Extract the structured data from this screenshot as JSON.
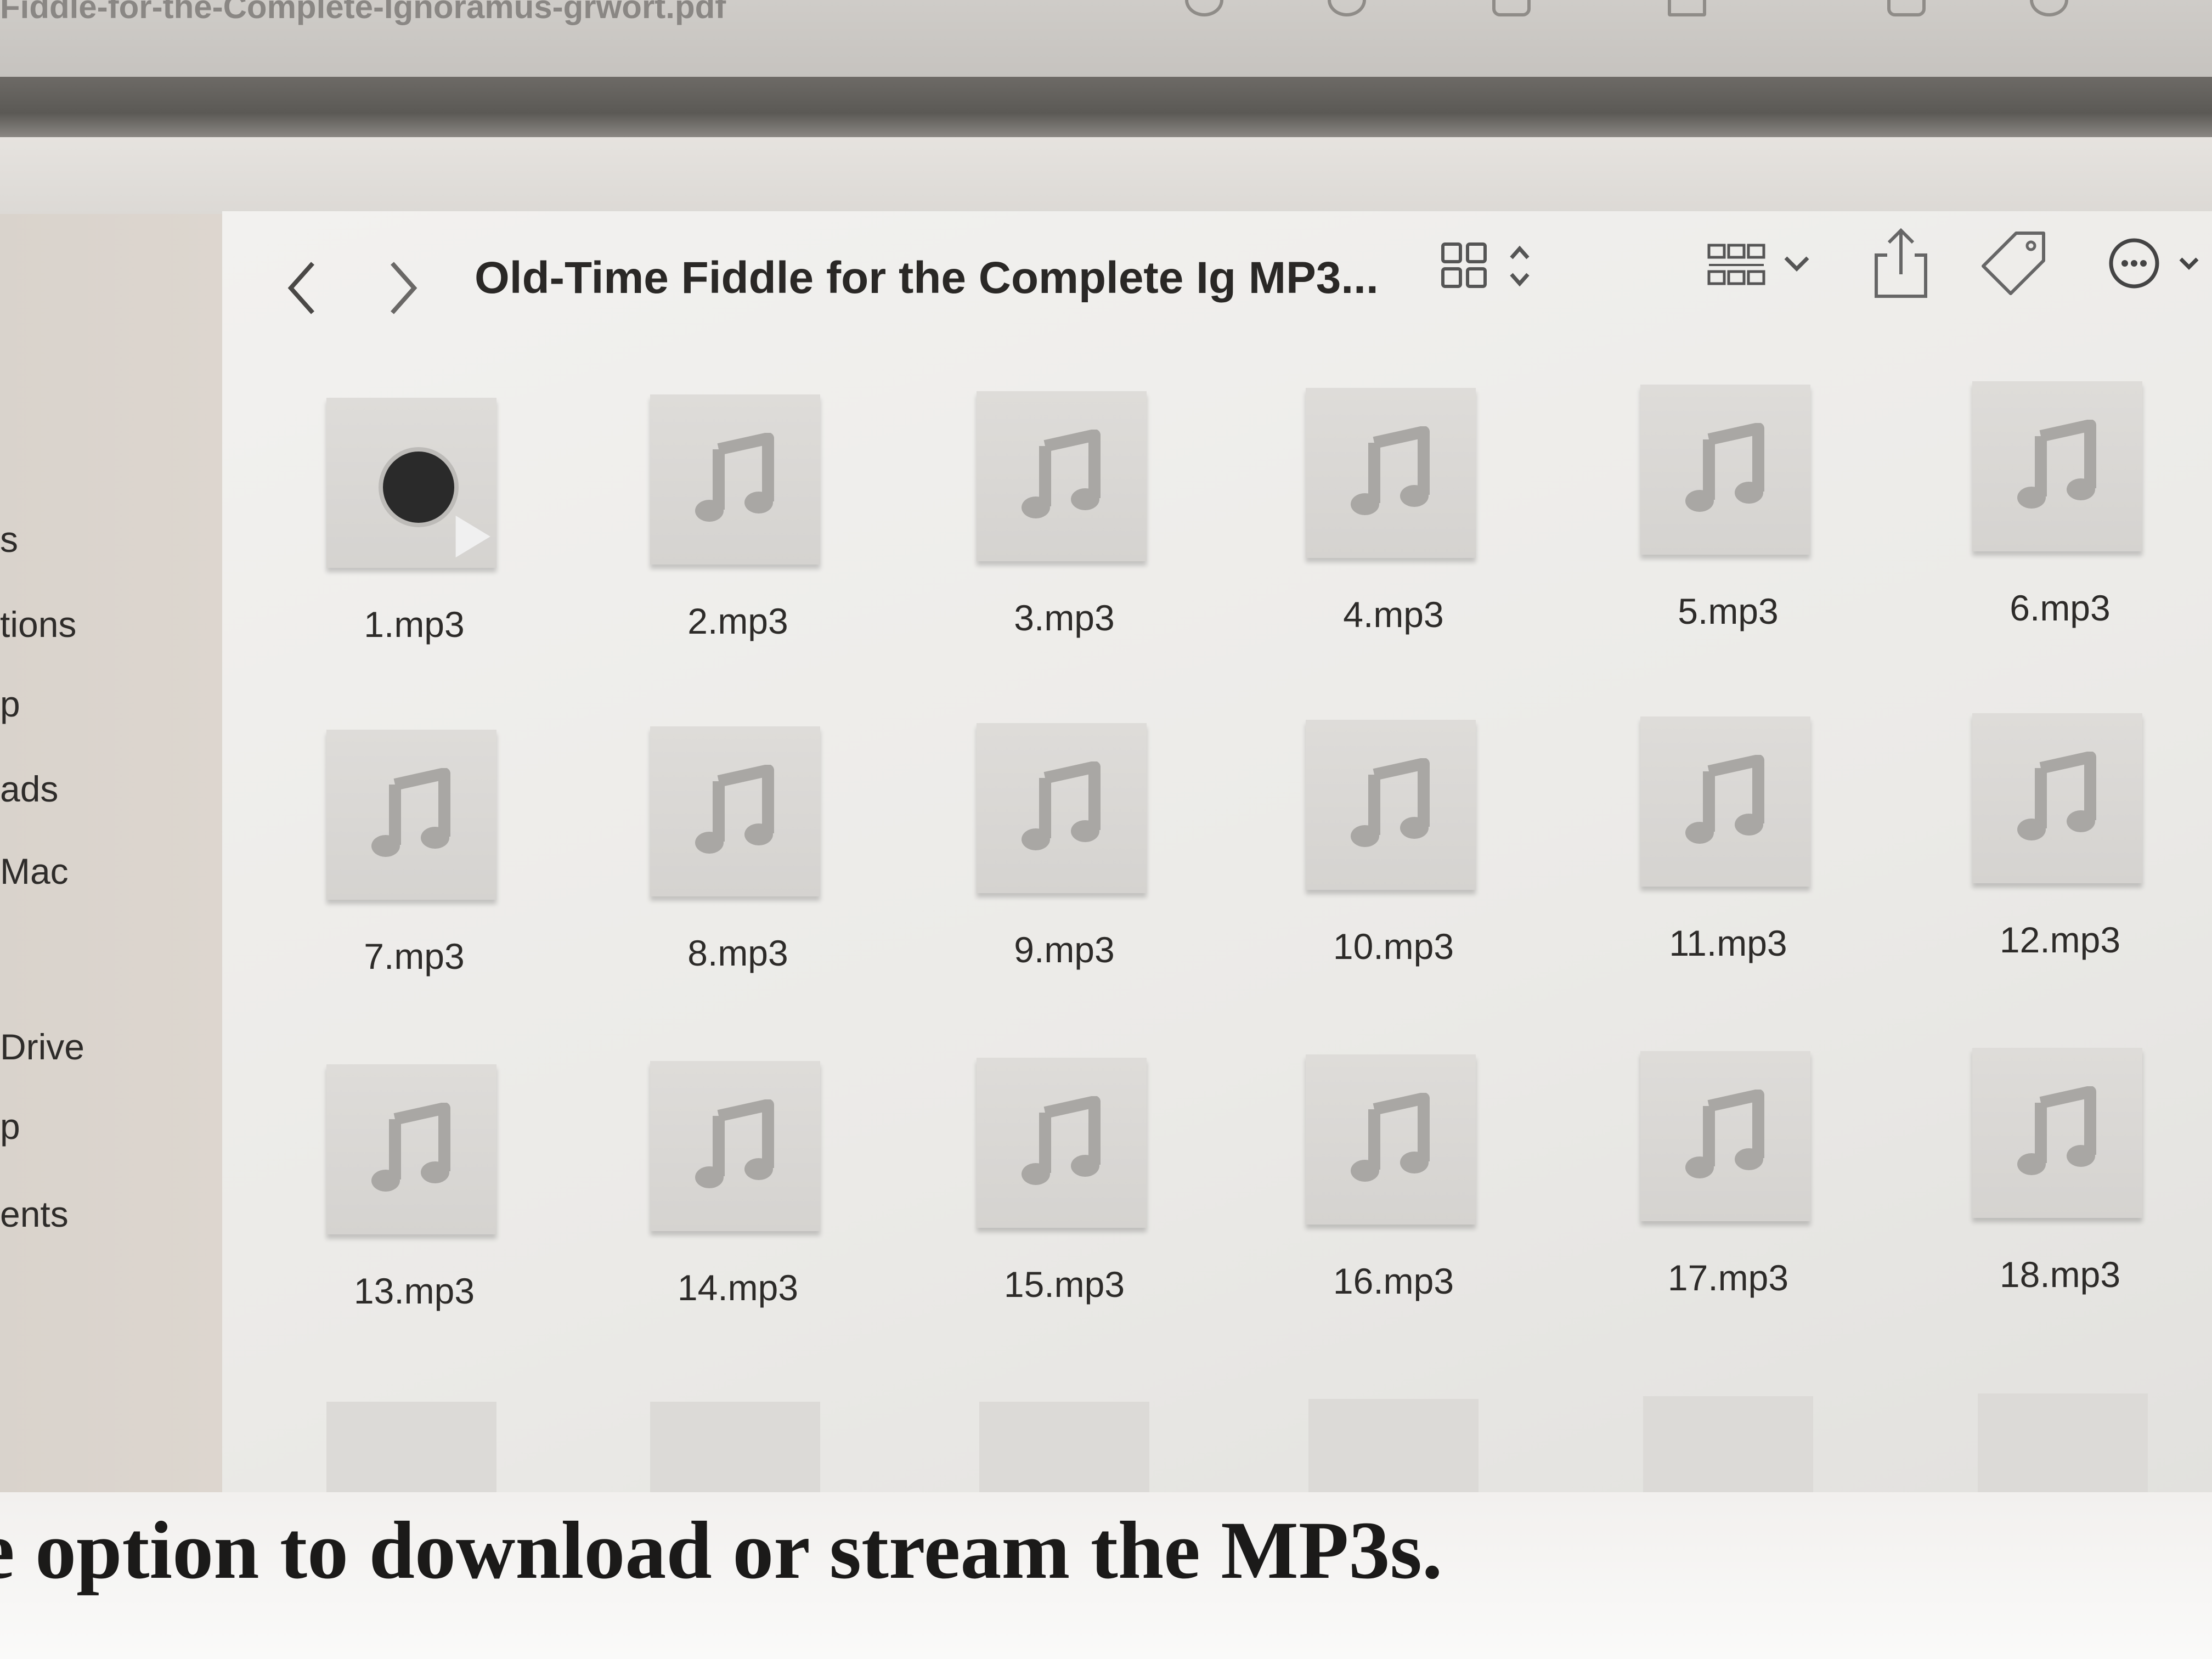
{
  "pdf_window": {
    "title": "Fiddle-for-the-Complete-Ignoramus-grwort.pdf"
  },
  "sidebar": {
    "items": [
      {
        "label": "s"
      },
      {
        "label": "tions"
      },
      {
        "label": "p"
      },
      {
        "label": "ads"
      },
      {
        "label": "Mac"
      },
      {
        "label": "Drive"
      },
      {
        "label": "p"
      },
      {
        "label": "ents"
      }
    ]
  },
  "finder": {
    "title": "Old-Time Fiddle for the Complete Ig MP3...",
    "back_icon": "chevron-left-icon",
    "forward_icon": "chevron-right-icon",
    "toolbar_icons": [
      "icon-view-icon",
      "group-by-icon",
      "share-icon",
      "tag-icon",
      "more-actions-icon"
    ],
    "files": [
      {
        "name": "1.mp3",
        "playing": true
      },
      {
        "name": "2.mp3"
      },
      {
        "name": "3.mp3"
      },
      {
        "name": "4.mp3"
      },
      {
        "name": "5.mp3"
      },
      {
        "name": "6.mp3"
      },
      {
        "name": "7.mp3"
      },
      {
        "name": "8.mp3"
      },
      {
        "name": "9.mp3"
      },
      {
        "name": "10.mp3"
      },
      {
        "name": "11.mp3"
      },
      {
        "name": "12.mp3"
      },
      {
        "name": "13.mp3"
      },
      {
        "name": "14.mp3"
      },
      {
        "name": "15.mp3"
      },
      {
        "name": "16.mp3"
      },
      {
        "name": "17.mp3"
      },
      {
        "name": "18.mp3"
      }
    ]
  },
  "pdf_page": {
    "text": "e option to download or stream the MP3s."
  }
}
